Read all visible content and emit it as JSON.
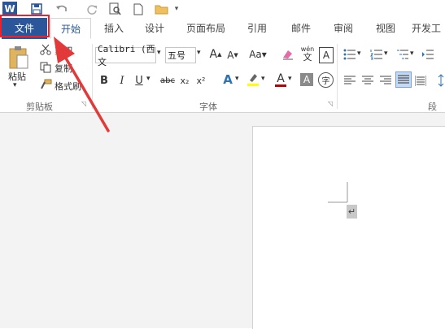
{
  "qat": {
    "app_icon": "W",
    "save_icon": "save-icon",
    "undo_icon": "undo-icon",
    "redo_icon": "redo-icon",
    "print_preview_icon": "print-preview-icon",
    "new_icon": "new-doc-icon",
    "open_icon": "open-folder-icon"
  },
  "tabs": [
    {
      "label": "文件"
    },
    {
      "label": "开始"
    },
    {
      "label": "插入"
    },
    {
      "label": "设计"
    },
    {
      "label": "页面布局"
    },
    {
      "label": "引用"
    },
    {
      "label": "邮件"
    },
    {
      "label": "审阅"
    },
    {
      "label": "视图"
    },
    {
      "label": "开发工"
    }
  ],
  "clipboard": {
    "paste": "粘贴",
    "cut": "剪切",
    "copy": "复制",
    "format_painter": "格式刷",
    "group": "剪贴板"
  },
  "font": {
    "name": "Calibri (西文",
    "size": "五号",
    "group": "字体",
    "wen": "wén",
    "wen2": "文",
    "a_box": "A",
    "bold": "B",
    "italic": "I",
    "underline": "U",
    "strike": "abc",
    "sub": "x₂",
    "sup": "x²"
  },
  "paragraph": {
    "group": "段落"
  },
  "document": {
    "paragraph_mark": "↵"
  },
  "colors": {
    "file_tab": "#2b579a",
    "highlight": "#e8232d",
    "font_color": "#c00000",
    "highlight_color": "#ffff00"
  }
}
